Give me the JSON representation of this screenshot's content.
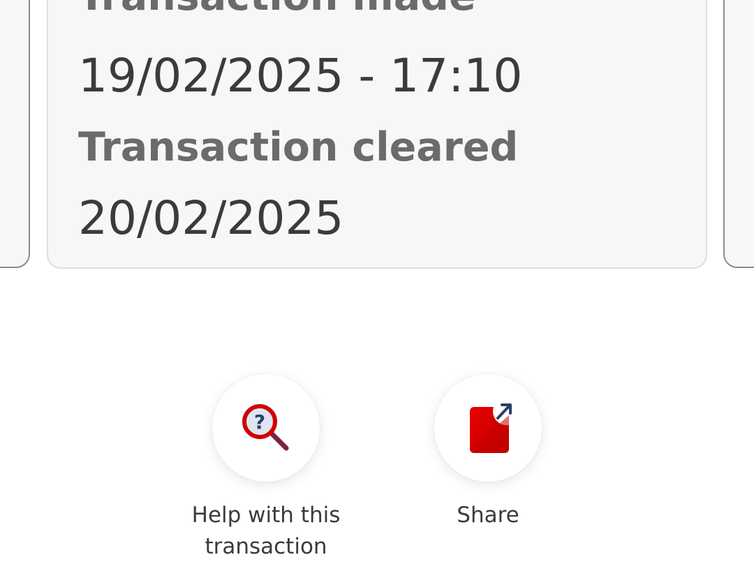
{
  "transaction_details": {
    "made_label": "Transaction made",
    "made_value": "19/02/2025 - 17:10",
    "cleared_label": "Transaction cleared",
    "cleared_value": "20/02/2025"
  },
  "actions": {
    "help": {
      "label_line1": "Help with this",
      "label_line2": "transaction",
      "icon": "magnifier-question-icon"
    },
    "share": {
      "label": "Share",
      "icon": "share-icon"
    }
  },
  "colors": {
    "brand_red": "#ec0000",
    "dark_red": "#b40000",
    "icon_navy": "#2c3e66",
    "card_background": "#f6f7f9",
    "label_gray": "#6b6b6b",
    "value_text": "#3a3b3d"
  }
}
